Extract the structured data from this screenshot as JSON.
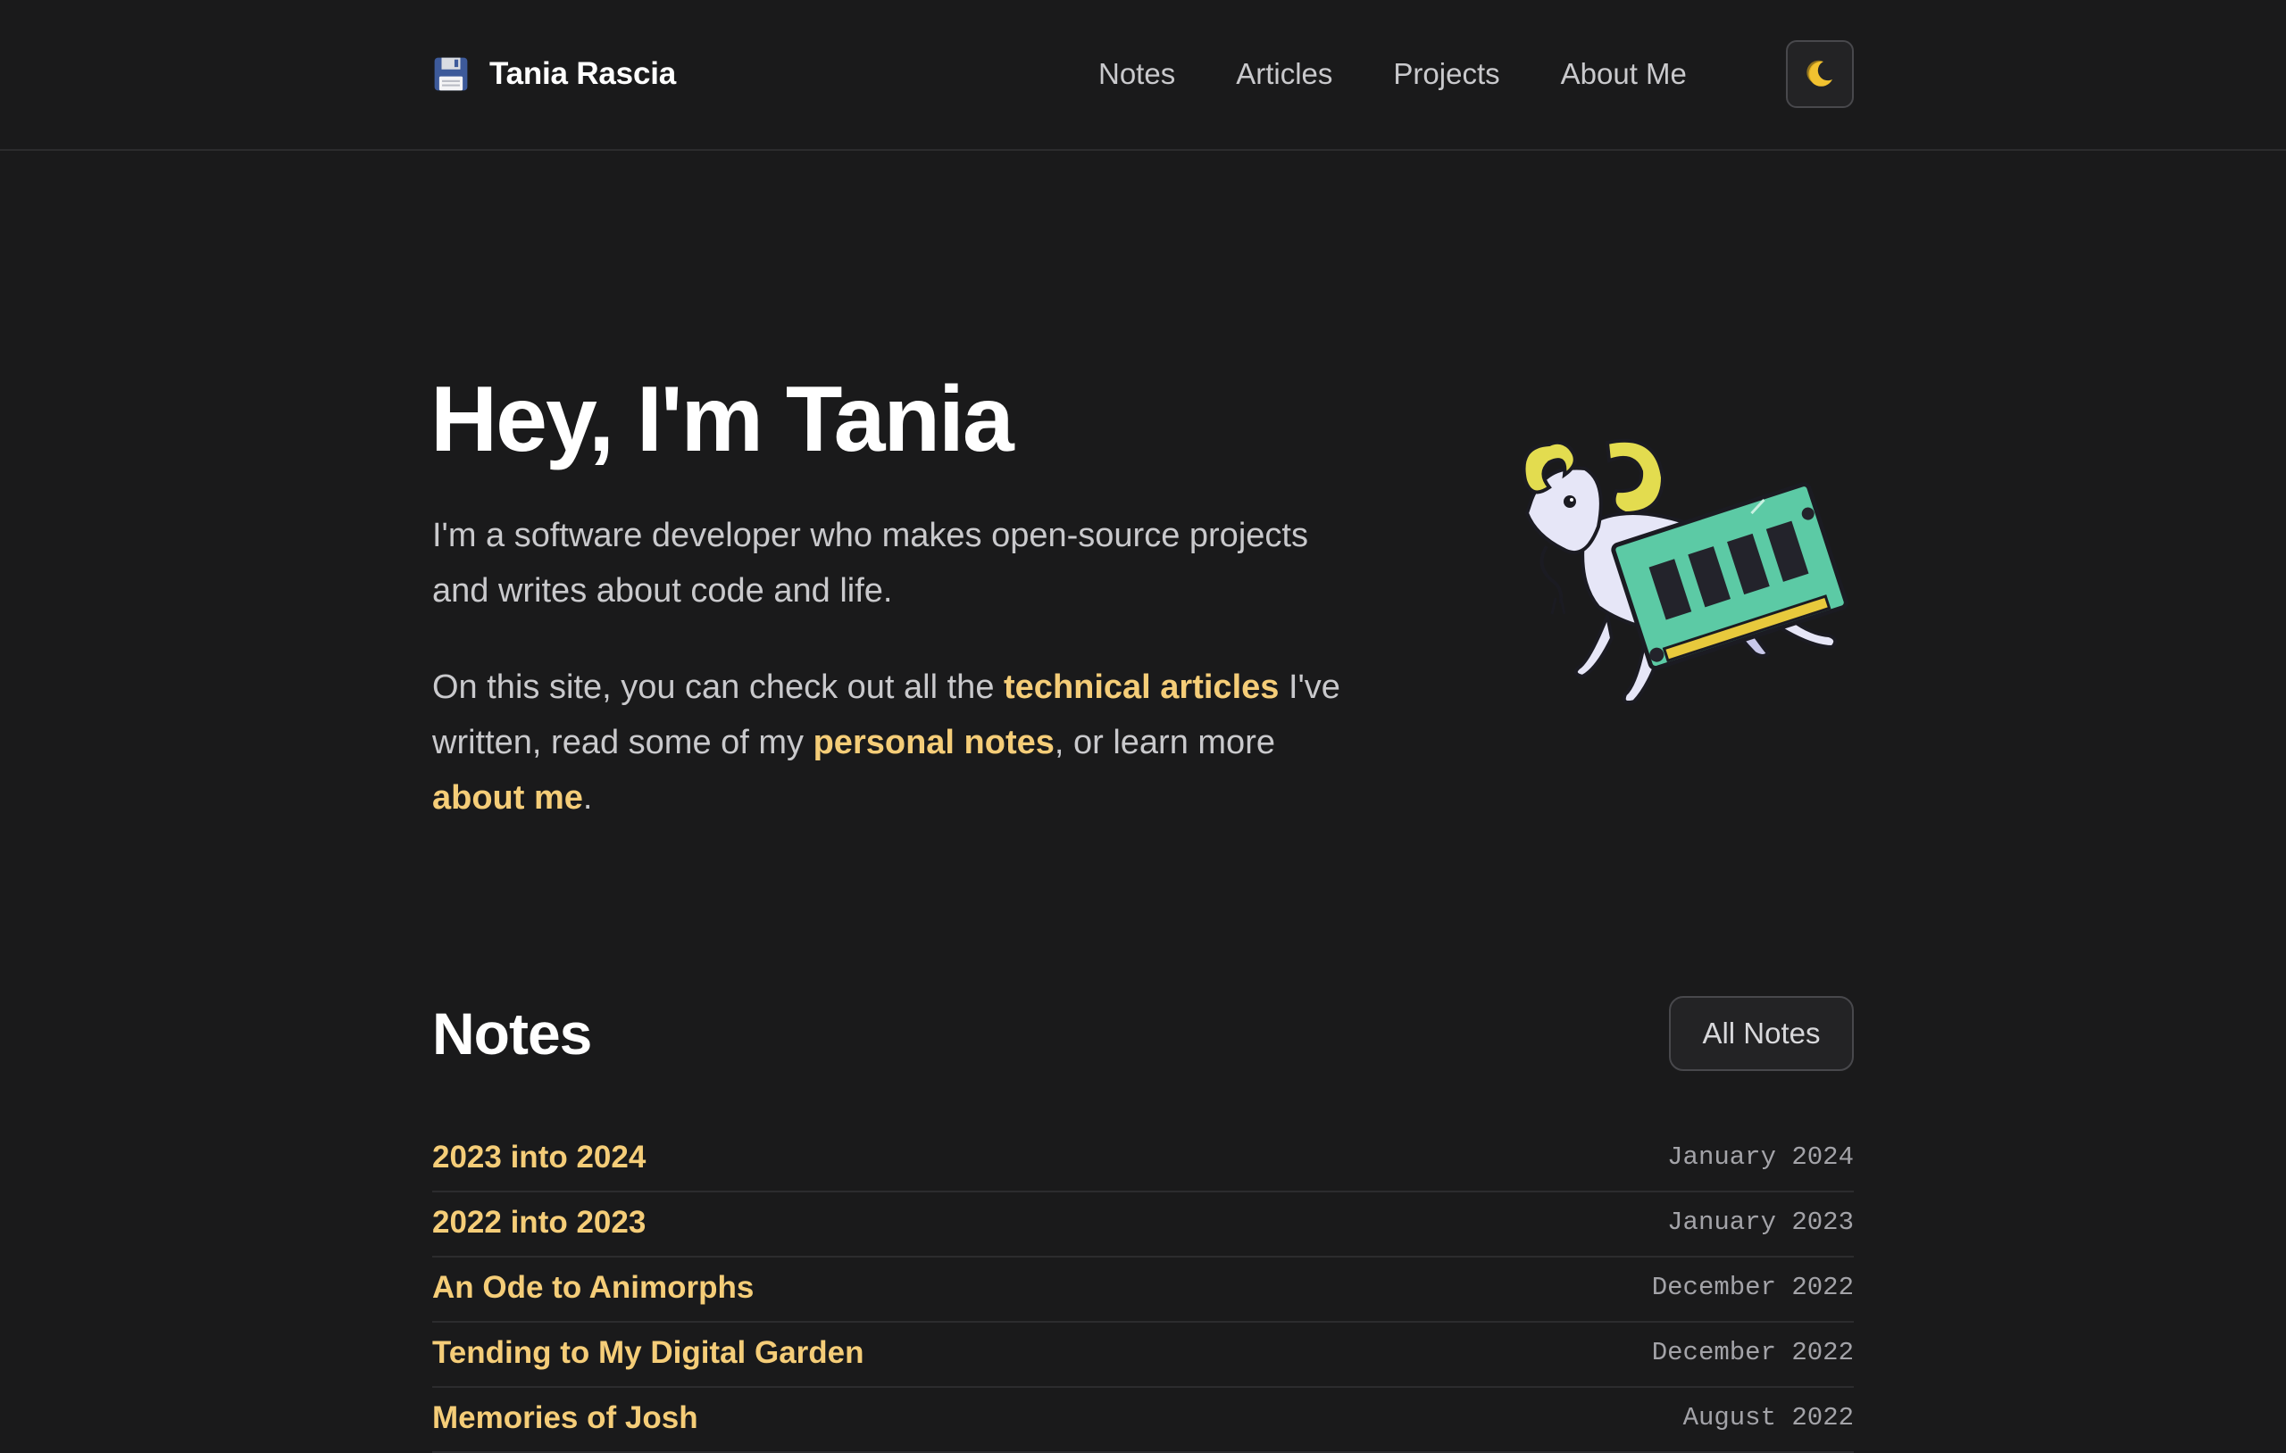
{
  "header": {
    "brand_icon": "floppy-disk-icon",
    "brand_name": "Tania Rascia",
    "nav": [
      "Notes",
      "Articles",
      "Projects",
      "About Me"
    ],
    "theme_toggle_icon": "crescent-moon-icon"
  },
  "hero": {
    "title": "Hey, I'm Tania",
    "intro": "I'm a software developer who makes open-source projects and writes about code and life.",
    "more": {
      "part1": "On this site, you can check out all the ",
      "link_technical_articles": "technical articles",
      "part2": " I've written, read some of my ",
      "link_personal_notes": "personal notes",
      "part3": ", or learn more ",
      "link_about_me": "about me",
      "part4": "."
    },
    "illustration": "ram-goat-carrying-memory-stick"
  },
  "notes_section": {
    "title": "Notes",
    "all_button": "All Notes",
    "items": [
      {
        "title": "2023 into 2024",
        "date": "January 2024"
      },
      {
        "title": "2022 into 2023",
        "date": "January 2023"
      },
      {
        "title": "An Ode to Animorphs",
        "date": "December 2022"
      },
      {
        "title": "Tending to My Digital Garden",
        "date": "December 2022"
      },
      {
        "title": "Memories of Josh",
        "date": "August 2022"
      }
    ]
  },
  "colors": {
    "background": "#1a1a1b",
    "accent": "#f5cd78",
    "text_muted": "#c9c9cc",
    "border": "#2c2c2e"
  }
}
